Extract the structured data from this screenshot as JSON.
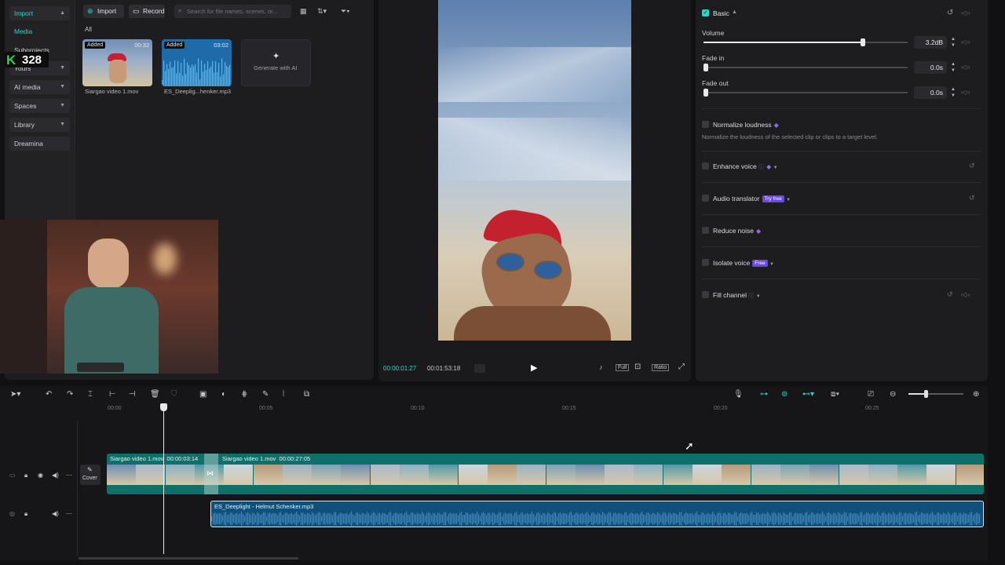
{
  "nav": {
    "import": "Import",
    "media": "Media",
    "subprojects": "Subprojects",
    "yours": "Yours",
    "ai_media": "AI media",
    "spaces": "Spaces",
    "library": "Library",
    "dreamina": "Dreamina"
  },
  "overlay_badge": {
    "letter": "K",
    "count": "328"
  },
  "media_toolbar": {
    "import_label": "Import",
    "record_label": "Record",
    "search_placeholder": "Search for file names, scenes, or..."
  },
  "media_filter": "All",
  "media_items": [
    {
      "tag": "Added",
      "duration": "00:32",
      "name": "Siargao video 1.mov"
    },
    {
      "tag": "Added",
      "duration": "03:02",
      "name": "ES_Deeplig...henker.mp3"
    }
  ],
  "generate_ai": "Generate with AI",
  "player": {
    "current_time": "00:00:01:27",
    "total_time": "00:01:53:18",
    "full_label": "Full",
    "ratio_label": "Ratio"
  },
  "audio_panel": {
    "section": "Basic",
    "volume_label": "Volume",
    "volume_value": "3.2dB",
    "volume_level": 0.78,
    "fade_in_label": "Fade in",
    "fade_in_value": "0.0s",
    "fade_out_label": "Fade out",
    "fade_out_value": "0.0s",
    "normalize_label": "Normalize loudness",
    "normalize_desc": "Normalize the loudness of the selected clip or clips to a target level.",
    "enhance_label": "Enhance voice",
    "translator_label": "Audio translator",
    "translator_pill": "Try free",
    "reduce_noise_label": "Reduce noise",
    "isolate_label": "Isolate voice",
    "isolate_pill": "Free",
    "fill_channel_label": "Fill channel",
    "accent": "#2fd2c6"
  },
  "timeline": {
    "ticks": [
      "00:00",
      "00:05",
      "00:10",
      "00:15",
      "00:20",
      "00:25"
    ],
    "cover_label": "Cover",
    "clip1_name": "Siargao video 1.mov",
    "clip1_duration": "00:00:03:14",
    "clip2_name": "Siargao video 1.mov",
    "clip2_duration": "00:00:27:05",
    "audio_name": "ES_Deeplight - Helmut Schenker.mp3",
    "video_track_color": "#0f6f6a",
    "audio_track_color": "#10507d"
  }
}
